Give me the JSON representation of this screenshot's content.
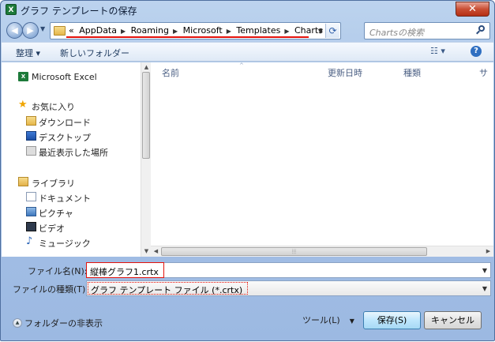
{
  "window": {
    "title": "グラフ テンプレートの保存",
    "app_icon": "X",
    "close_glyph": "✕"
  },
  "address": {
    "prefix": "«",
    "crumbs": [
      "AppData",
      "Roaming",
      "Microsoft",
      "Templates",
      "Charts"
    ]
  },
  "search": {
    "placeholder": "Chartsの検索"
  },
  "toolbar": {
    "organize": "整理 ▾",
    "new_folder": "新しいフォルダー",
    "view": "☷ ▾",
    "help": "?"
  },
  "nav": {
    "items": [
      {
        "label": "Microsoft Excel",
        "icon": "excel-icon"
      },
      {
        "label": "お気に入り",
        "icon": "star-icon"
      },
      {
        "label": "ダウンロード",
        "icon": "download-folder-icon"
      },
      {
        "label": "デスクトップ",
        "icon": "desktop-icon"
      },
      {
        "label": "最近表示した場所",
        "icon": "recent-places-icon"
      },
      {
        "label": "ライブラリ",
        "icon": "library-icon"
      },
      {
        "label": "ドキュメント",
        "icon": "documents-icon"
      },
      {
        "label": "ピクチャ",
        "icon": "pictures-icon"
      },
      {
        "label": "ビデオ",
        "icon": "videos-icon"
      },
      {
        "label": "ミュージック",
        "icon": "music-icon"
      }
    ]
  },
  "columns": [
    "名前",
    "更新日時",
    "種類",
    "サ"
  ],
  "form": {
    "filename_label": "ファイル名(N):",
    "filename_value": "縦棒グラフ1.crtx",
    "filetype_label": "ファイルの種類(T):",
    "filetype_value": "グラフ テンプレート ファイル (*.crtx)"
  },
  "footer": {
    "hide_folders": "フォルダーの非表示",
    "tools": "ツール(L)",
    "save": "保存(S)",
    "cancel": "キャンセル"
  },
  "colors": {
    "highlight": "#e3120b",
    "accent": "#3c7fb1"
  }
}
